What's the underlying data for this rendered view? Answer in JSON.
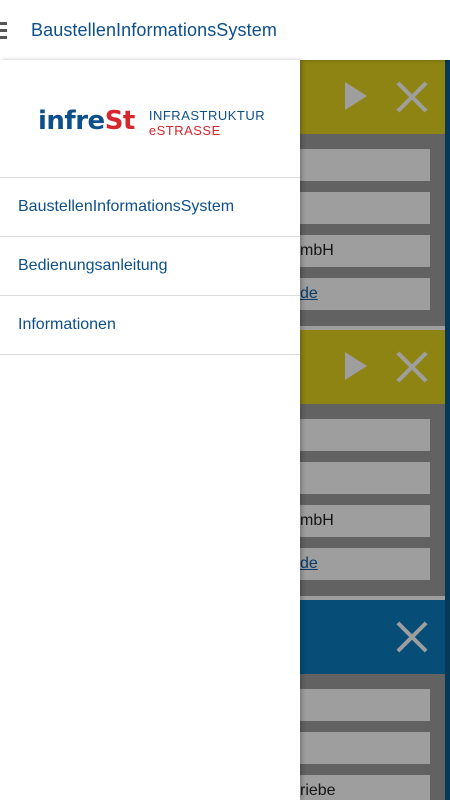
{
  "appbar": {
    "title": "BaustellenInformationsSystem",
    "menu_icon": "hamburger-menu-icon"
  },
  "drawer": {
    "logo": {
      "mark_part1": "infre",
      "mark_part2": "St",
      "line1": "INFRASTRUKTUR",
      "line2": "eSTRASSE"
    },
    "items": [
      {
        "label": "BaustellenInformationsSystem"
      },
      {
        "label": "Bedienungsanleitung"
      },
      {
        "label": "Informationen"
      }
    ]
  },
  "background": {
    "cards": [
      {
        "header_color": "#e6d520",
        "rows": [
          "",
          "",
          "mbH",
          "de"
        ]
      },
      {
        "header_color": "#e6d520",
        "rows": [
          "",
          "",
          "mbH",
          "de"
        ]
      },
      {
        "header_color": "#0b7cc1",
        "rows": [
          "",
          "",
          "riebe"
        ]
      }
    ]
  },
  "colors": {
    "brand_blue": "#0d4f8b",
    "brand_red": "#d6262e",
    "card_yellow": "#e6d520",
    "card_blue": "#0b7cc1"
  }
}
